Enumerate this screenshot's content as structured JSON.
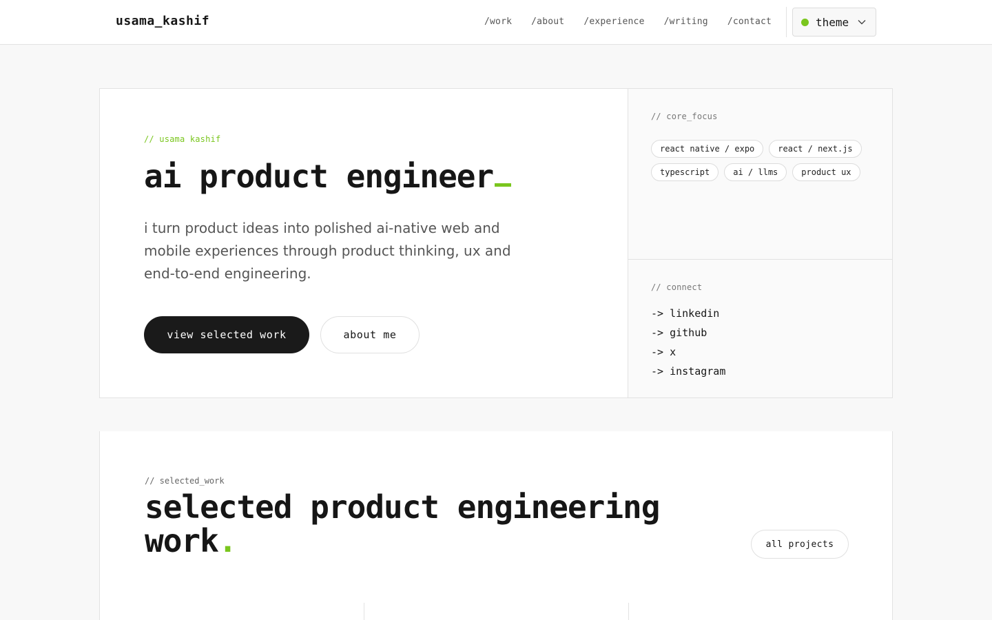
{
  "header": {
    "logo": "usama_kashif",
    "nav": [
      "/work",
      "/about",
      "/experience",
      "/writing",
      "/contact"
    ],
    "theme_label": "theme",
    "chevron": "⌄"
  },
  "hero": {
    "kicker": "// usama kashif",
    "title": "ai product engineer",
    "description": "i turn product ideas into polished ai-native web and mobile experiences through product thinking, ux and end-to-end engineering.",
    "primary_cta": "view selected work",
    "secondary_cta": "about me"
  },
  "focus": {
    "kicker": "// core_focus",
    "tags": [
      "react native / expo",
      "react / next.js",
      "typescript",
      "ai / llms",
      "product ux"
    ]
  },
  "connect": {
    "kicker": "// connect",
    "links": [
      "-> linkedin",
      "-> github",
      "-> x",
      "-> instagram"
    ]
  },
  "work": {
    "kicker": "// selected_work",
    "title": "selected product engineering work",
    "title_dot": ".",
    "all_projects": "all projects"
  },
  "colors": {
    "accent": "#7ac61e",
    "dark": "#1a1a1a"
  }
}
